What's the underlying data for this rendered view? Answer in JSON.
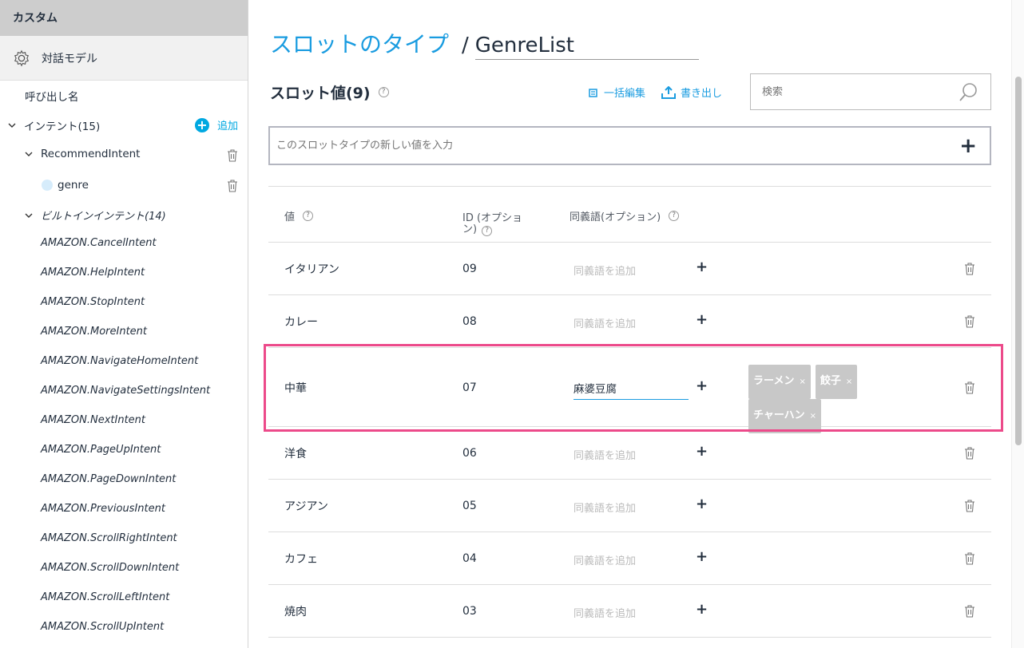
{
  "sidebar": {
    "header": "カスタム",
    "model_label": "対話モデル",
    "invocation": "呼び出し名",
    "intents_label": "インテント(15)",
    "add_label": "追加",
    "recommend_intent": "RecommendIntent",
    "slot_genre": "genre",
    "builtin_label": "ビルトインインテント(14)",
    "builtins": [
      "AMAZON.CancelIntent",
      "AMAZON.HelpIntent",
      "AMAZON.StopIntent",
      "AMAZON.MoreIntent",
      "AMAZON.NavigateHomeIntent",
      "AMAZON.NavigateSettingsIntent",
      "AMAZON.NextIntent",
      "AMAZON.PageUpIntent",
      "AMAZON.PageDownIntent",
      "AMAZON.PreviousIntent",
      "AMAZON.ScrollRightIntent",
      "AMAZON.ScrollDownIntent",
      "AMAZON.ScrollLeftIntent",
      "AMAZON.ScrollUpIntent"
    ]
  },
  "main": {
    "title_link": "スロットのタイプ",
    "title_sep": "/",
    "slot_type_name": "GenreList",
    "section_title": "スロット値(9)",
    "bulk_edit": "一括編集",
    "export": "書き出し",
    "search_placeholder": "検索",
    "new_value_placeholder": "このスロットタイプの新しい値を入力",
    "headers": {
      "value": "値",
      "id": "ID (オプショ\nン)",
      "synonyms": "同義語(オプション)"
    },
    "synonym_placeholder": "同義語を追加",
    "rows": [
      {
        "value": "イタリアン",
        "id": "09"
      },
      {
        "value": "カレー",
        "id": "08"
      },
      {
        "value": "中華",
        "id": "07",
        "synonym_input": "麻婆豆腐",
        "chips": [
          "ラーメン",
          "餃子",
          "チャーハン"
        ]
      },
      {
        "value": "洋食",
        "id": "06"
      },
      {
        "value": "アジアン",
        "id": "05"
      },
      {
        "value": "カフェ",
        "id": "04"
      },
      {
        "value": "焼肉",
        "id": "03"
      }
    ]
  },
  "colors": {
    "accent": "#1a9ce0",
    "highlight": "#ec4a8a"
  }
}
